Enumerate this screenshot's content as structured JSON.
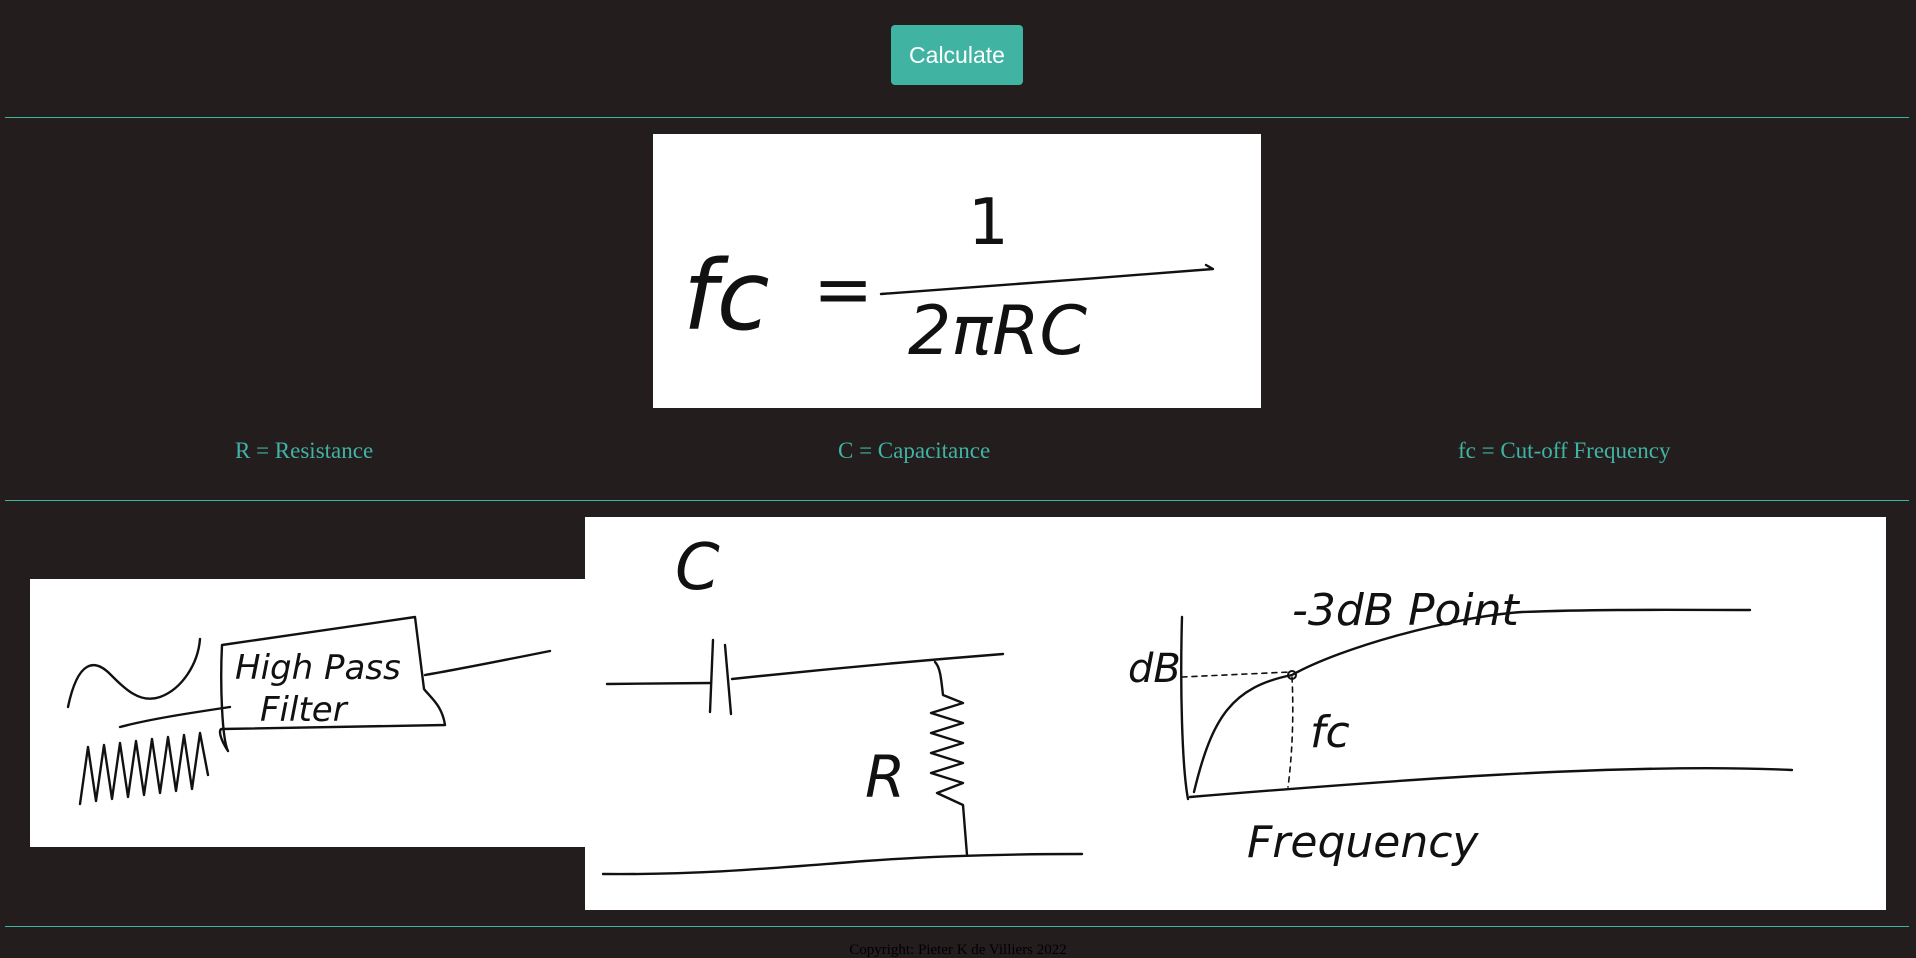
{
  "toolbar": {
    "calculate_label": "Calculate"
  },
  "legend": {
    "resistance": "R = Resistance",
    "capacitance": "C = Capacitance",
    "cutoff": "fc = Cut-off Frequency"
  },
  "sketches": {
    "formula": {
      "lhs": "fc",
      "equals": "=",
      "numerator": "1",
      "denominator": "2πRC"
    },
    "high_pass": {
      "line1": "High Pass",
      "line2": "Filter"
    },
    "circuit": {
      "capacitor_label": "C",
      "resistor_label": "R"
    },
    "response": {
      "y_label": "dB",
      "point_label": "-3dB Point",
      "cutoff_label": "fc",
      "x_label": "Frequency"
    }
  },
  "footer": {
    "copyright": "Copyright: Pieter K de Villiers 2022"
  },
  "colors": {
    "accent": "#41b3a3",
    "background": "#231d1e",
    "sketch_background": "#ffffff"
  }
}
